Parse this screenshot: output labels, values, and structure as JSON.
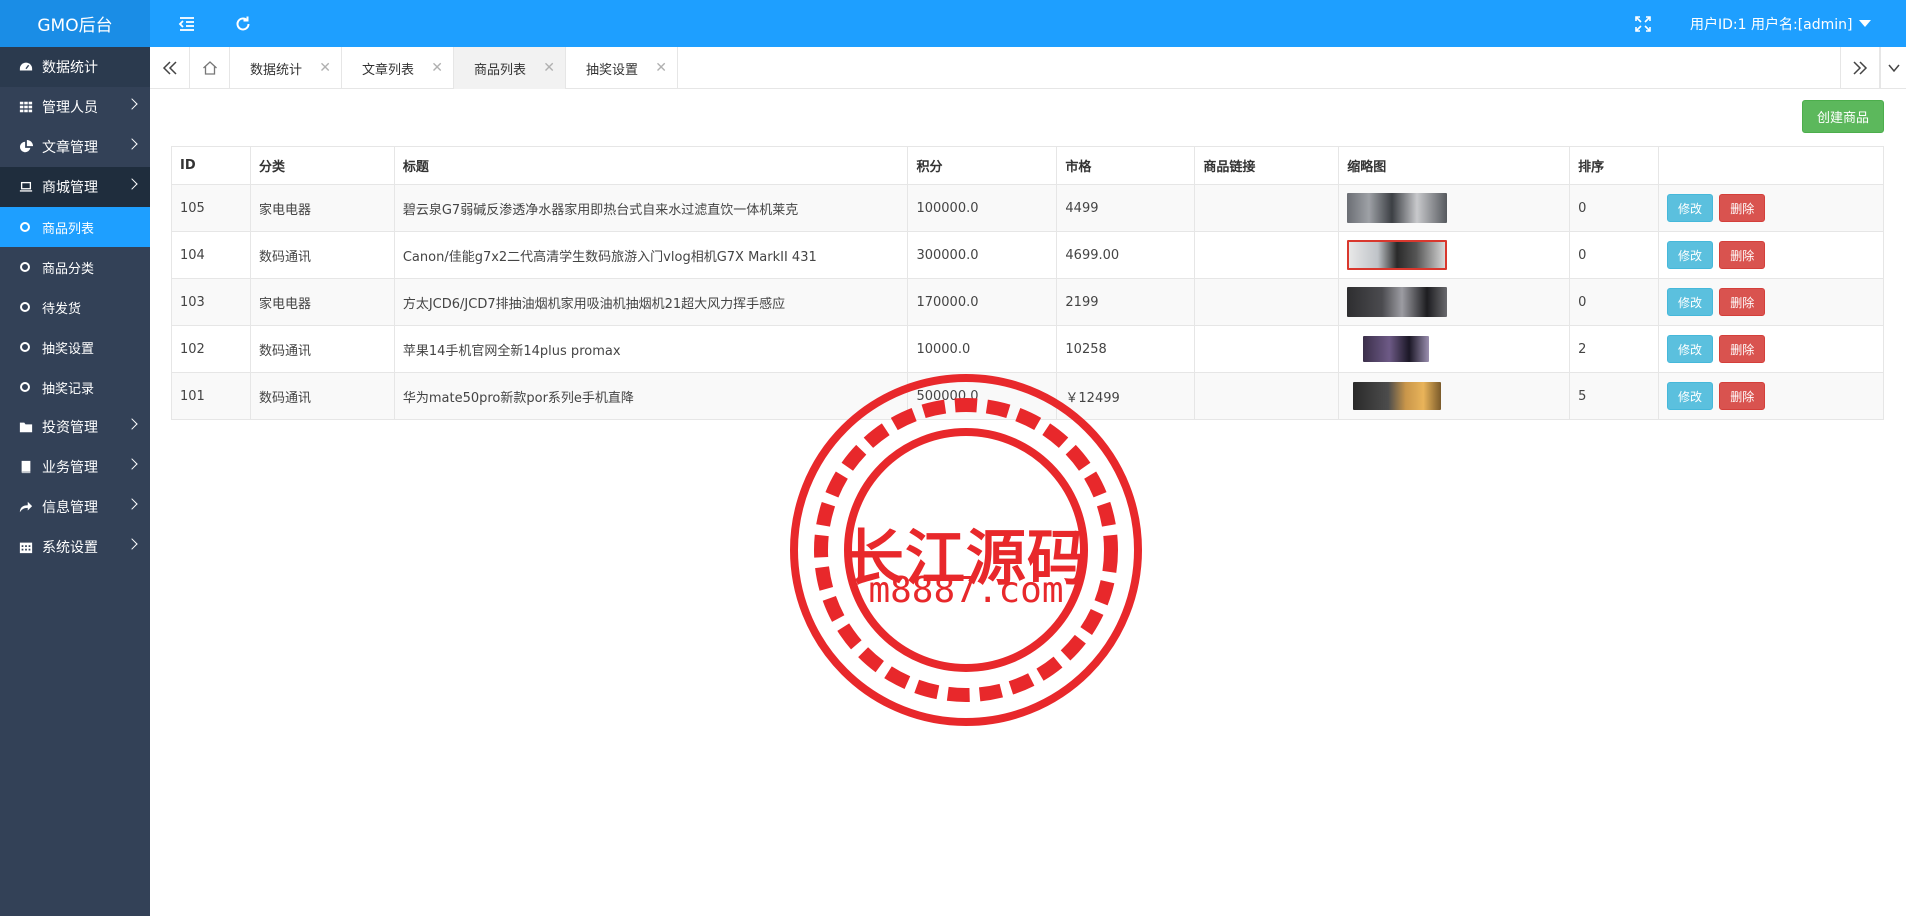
{
  "app": {
    "brand": "GMO后台"
  },
  "header": {
    "user_label": "用户ID:1 用户名:[admin]",
    "colors": {
      "topbar": "#1e9fff",
      "sidebar": "#334157",
      "active": "#1e9fff"
    }
  },
  "sidebar": {
    "items": [
      {
        "label": "数据统计",
        "icon": "dashboard-icon"
      },
      {
        "label": "管理人员",
        "icon": "grid-icon"
      },
      {
        "label": "文章管理",
        "icon": "pie-chart-icon"
      },
      {
        "label": "商城管理",
        "icon": "laptop-icon"
      },
      {
        "label": "投资管理",
        "icon": "folder-icon"
      },
      {
        "label": "业务管理",
        "icon": "book-icon"
      },
      {
        "label": "信息管理",
        "icon": "share-icon"
      },
      {
        "label": "系统设置",
        "icon": "calendar-icon"
      }
    ],
    "sub_items": [
      {
        "label": "商品列表",
        "active": true
      },
      {
        "label": "商品分类"
      },
      {
        "label": "待发货"
      },
      {
        "label": "抽奖设置"
      },
      {
        "label": "抽奖记录"
      }
    ]
  },
  "tabs": [
    {
      "label": "数据统计",
      "closable": false
    },
    {
      "label": "文章列表",
      "closable": true
    },
    {
      "label": "商品列表",
      "closable": true,
      "active": true
    },
    {
      "label": "抽奖设置",
      "closable": true
    }
  ],
  "toolbar": {
    "create_label": "创建商品"
  },
  "table": {
    "headers": [
      "ID",
      "分类",
      "标题",
      "积分",
      "市格",
      "商品链接",
      "缩略图",
      "排序",
      ""
    ],
    "edit_label": "修改",
    "delete_label": "删除",
    "rows": [
      {
        "id": "105",
        "category": "家电电器",
        "title": "碧云泉G7弱碱反渗透净水器家用即热台式自来水过滤直饮一体机莱克",
        "points": "100000.0",
        "price": "4499",
        "link": "",
        "sort": "0"
      },
      {
        "id": "104",
        "category": "数码通讯",
        "title": "Canon/佳能g7x2二代高清学生数码旅游入门vlog相机G7X MarkII 431",
        "points": "300000.0",
        "price": "4699.00",
        "link": "",
        "sort": "0"
      },
      {
        "id": "103",
        "category": "家电电器",
        "title": "方太JCD6/JCD7排抽油烟机家用吸油机抽烟机21超大风力挥手感应",
        "points": "170000.0",
        "price": "2199",
        "link": "",
        "sort": "0"
      },
      {
        "id": "102",
        "category": "数码通讯",
        "title": "苹果14手机官网全新14plus promax",
        "points": "10000.0",
        "price": "10258",
        "link": "",
        "sort": "2"
      },
      {
        "id": "101",
        "category": "数码通讯",
        "title": "华为mate50pro新款por系列e手机直降",
        "points": "500000.0",
        "price": "￥12499",
        "link": "",
        "sort": "5"
      }
    ]
  },
  "watermark": {
    "title": "长江源码",
    "url": "m8887.com",
    "color": "#e8282b"
  }
}
